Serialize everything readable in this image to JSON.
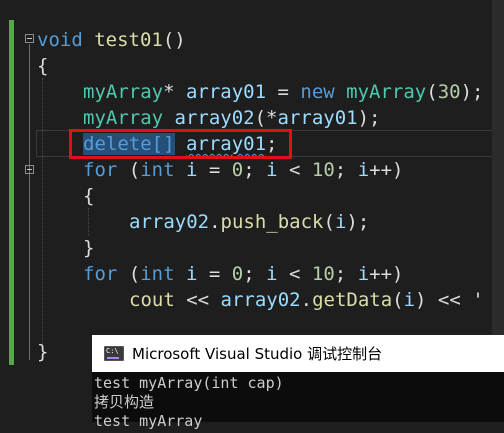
{
  "editor": {
    "lines": {
      "l1": {
        "kw": "void",
        "fn": "test01",
        "rest": "()"
      },
      "l2": {
        "text": "{"
      },
      "l3": {
        "ty": "myArray",
        "op": "* ",
        "var": "array01",
        "eq": " = ",
        "kw": "new",
        "sp": " ",
        "ty2": "myArray",
        "args_open": "(",
        "num": "30",
        "close": ");"
      },
      "l4": {
        "ty": "myArray",
        "sp": " ",
        "fn": "array02",
        "open": "(*",
        "var": "array01",
        "close": ");"
      },
      "l5": {
        "kw": "delete[]",
        "sp": " ",
        "var": "array01",
        "end": ";"
      },
      "l6": {
        "kw": "for",
        "a": " (",
        "kw2": "int",
        "b": " ",
        "var": "i",
        "c": " = ",
        "num": "0",
        "d": "; ",
        "var2": "i",
        "e": " < ",
        "num2": "10",
        "f": "; ",
        "var3": "i",
        "g": "++)"
      },
      "l7": {
        "text": "{"
      },
      "l8": {
        "var": "array02",
        "dot": ".",
        "fn": "push_back",
        "open": "(",
        "arg": "i",
        "close": ");"
      },
      "l9": {
        "text": "}"
      },
      "l10": {
        "kw": "for",
        "a": " (",
        "kw2": "int",
        "b": " ",
        "var": "i",
        "c": " = ",
        "num": "0",
        "d": "; ",
        "var2": "i",
        "e": " < ",
        "num2": "10",
        "f": "; ",
        "var3": "i",
        "g": "++)"
      },
      "l11": {
        "fn": "cout",
        "a": " << ",
        "var": "array02",
        "dot": ".",
        "fn2": "getData",
        "open": "(",
        "arg": "i",
        "close": ") << '"
      },
      "l12": {
        "text": "}"
      }
    }
  },
  "console": {
    "title": "Microsoft Visual Studio 调试控制台",
    "output": [
      "test myArray(int cap)",
      "拷贝构造",
      "test myArray"
    ]
  },
  "colors": {
    "background": "#1e1e1e",
    "keyword": "#569cd6",
    "type": "#4ec9b0",
    "function": "#dcdcaa",
    "number": "#b5cea8",
    "identifier": "#9cdcfe",
    "highlight_box": "#e0101a",
    "change_bar": "#57a64a"
  }
}
